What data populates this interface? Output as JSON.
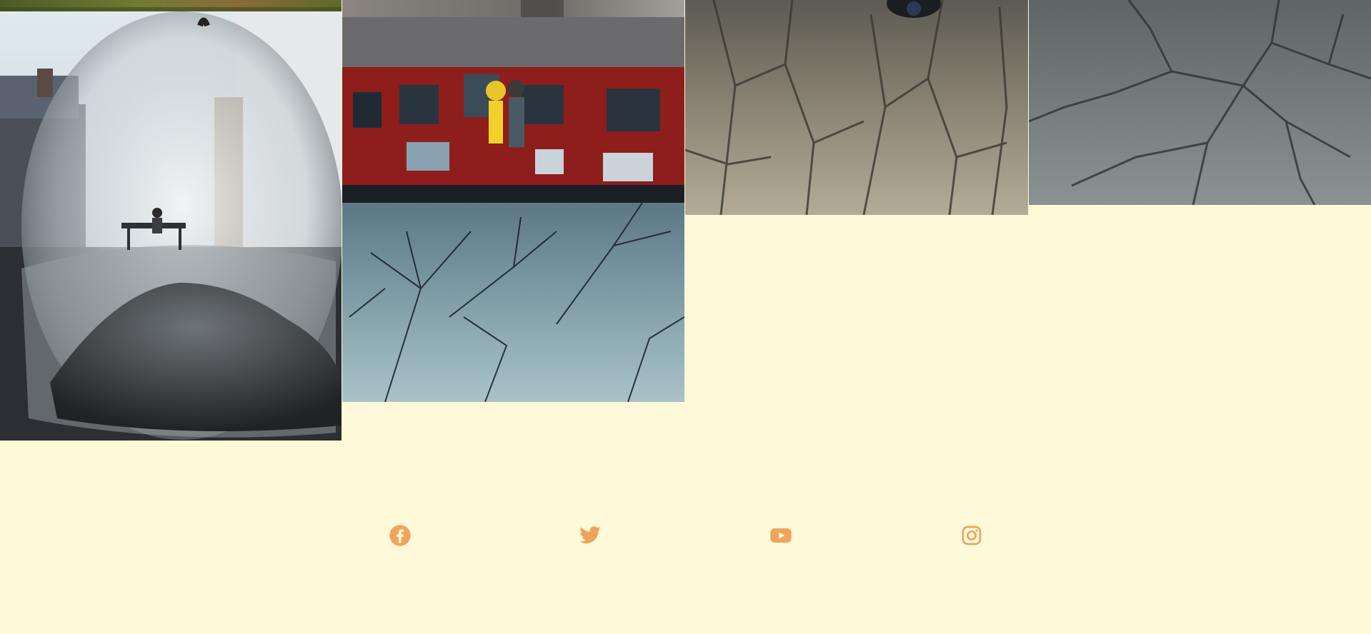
{
  "gallery": {
    "items": [
      {
        "subject": "grass-strip"
      },
      {
        "subject": "hourglass-figure-on-bench"
      },
      {
        "subject": "stone-surface"
      },
      {
        "subject": "couple-figures-reflection-red-building"
      },
      {
        "subject": "cracked-tree-bark"
      },
      {
        "subject": "tree-branches-reflection"
      }
    ]
  },
  "social": {
    "links": [
      {
        "icon": "facebook-icon"
      },
      {
        "icon": "twitter-icon"
      },
      {
        "icon": "youtube-icon"
      },
      {
        "icon": "instagram-icon"
      }
    ],
    "icon_color": "#f0a35c"
  },
  "colors": {
    "background": "#fef9d8",
    "accent": "#f0a35c"
  }
}
